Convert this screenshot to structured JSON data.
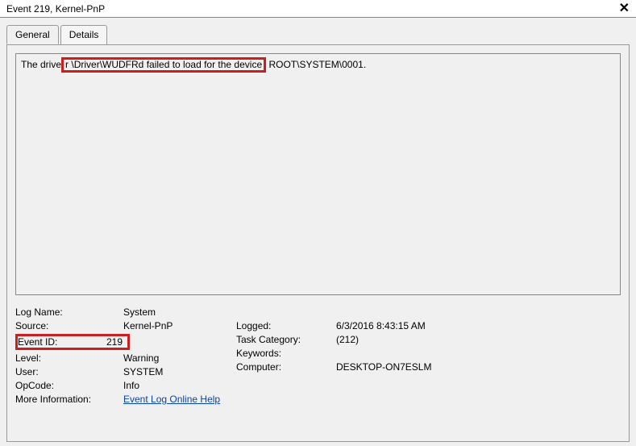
{
  "titlebar": {
    "title": "Event 219, Kernel-PnP"
  },
  "tabs": {
    "general": "General",
    "details": "Details"
  },
  "message": {
    "prefix": "The drive",
    "highlight": "r \\Driver\\WUDFRd failed to load for the device",
    "suffix": " ROOT\\SYSTEM\\0001."
  },
  "fields": {
    "logName": {
      "label": "Log Name:",
      "value": "System"
    },
    "source": {
      "label": "Source:",
      "value": "Kernel-PnP"
    },
    "eventId": {
      "label": "Event ID:",
      "value": "219"
    },
    "level": {
      "label": "Level:",
      "value": "Warning"
    },
    "user": {
      "label": "User:",
      "value": "SYSTEM"
    },
    "opcode": {
      "label": "OpCode:",
      "value": "Info"
    },
    "logged": {
      "label": "Logged:",
      "value": "6/3/2016 8:43:15 AM"
    },
    "taskCategory": {
      "label": "Task Category:",
      "value": "(212)"
    },
    "keywords": {
      "label": "Keywords:",
      "value": ""
    },
    "computer": {
      "label": "Computer:",
      "value": "DESKTOP-ON7ESLM"
    },
    "moreInfo": {
      "label": "More Information:",
      "link": "Event Log Online Help"
    }
  }
}
